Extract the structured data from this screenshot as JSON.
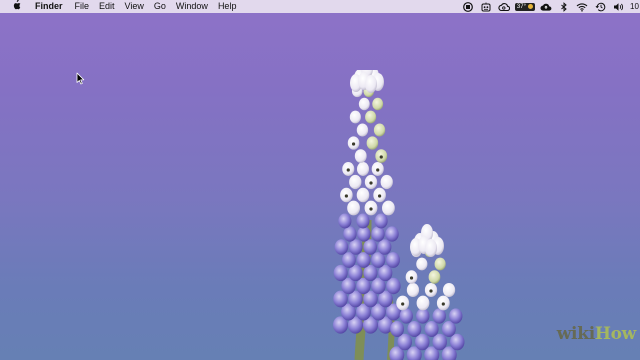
{
  "menubar": {
    "app_name": "Finder",
    "items": [
      "File",
      "Edit",
      "View",
      "Go",
      "Window",
      "Help"
    ],
    "status": {
      "temperature": "37°",
      "clock_partial": "10"
    },
    "status_icons": [
      "record-icon",
      "app-icon",
      "creative-cloud-icon",
      "weather-icon",
      "cloud-upload-icon",
      "bluetooth-icon",
      "wifi-icon",
      "time-machine-icon",
      "volume-icon"
    ]
  },
  "wallpaper": {
    "subject": "grape hyacinth flower",
    "colors": {
      "top": "#8e72c8",
      "bottom": "#6680b4"
    }
  },
  "watermark": {
    "part1": "wiki",
    "part2": "How"
  }
}
